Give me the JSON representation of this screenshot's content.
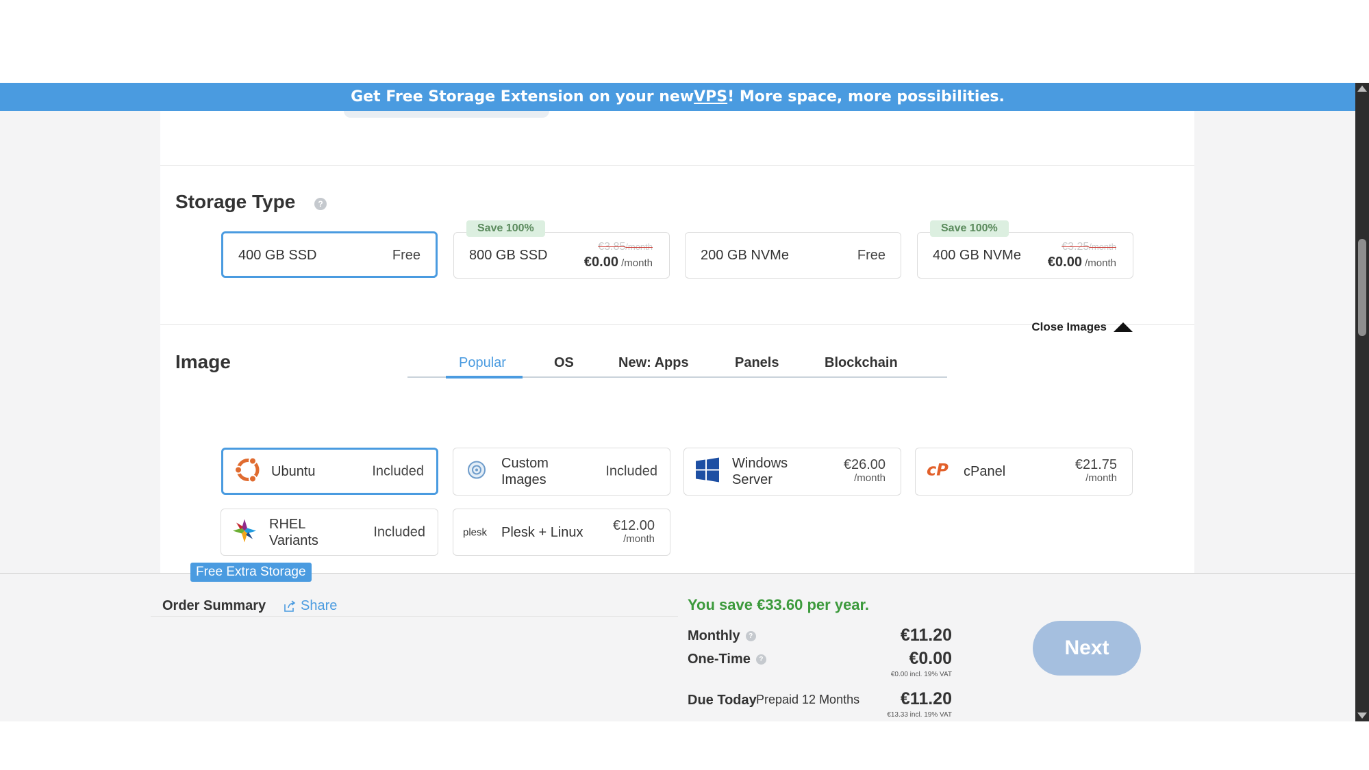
{
  "banner": {
    "text_before": "Get Free Storage Extension on your new ",
    "link": "VPS",
    "text_after": "! More space, more possibilities."
  },
  "storage": {
    "title": "Storage Type",
    "help": "?",
    "options": [
      {
        "name": "400 GB SSD",
        "price": "Free",
        "selected": true
      },
      {
        "name": "800 GB SSD",
        "save": "Save 100%",
        "old_price": "€3.85",
        "old_unit": "/month",
        "new_price": "€0.00",
        "new_unit": " /month"
      },
      {
        "name": "200 GB NVMe",
        "price": "Free"
      },
      {
        "name": "400 GB NVMe",
        "save": "Save 100%",
        "old_price": "€3.25",
        "old_unit": "/month",
        "new_price": "€0.00",
        "new_unit": " /month"
      }
    ]
  },
  "image": {
    "title": "Image",
    "close_label": "Close Images",
    "tabs": [
      "Popular",
      "OS",
      "New: Apps",
      "Panels",
      "Blockchain"
    ],
    "active_tab": "Popular",
    "options": [
      {
        "name": "Ubuntu",
        "price": "Included",
        "icon": "ubuntu-icon",
        "selected": true
      },
      {
        "name_line1": "Custom",
        "name_line2": "Images",
        "price": "Included",
        "icon": "custom-images-icon"
      },
      {
        "name_line1": "Windows",
        "name_line2": "Server",
        "price": "€26.00",
        "unit": "/month",
        "icon": "windows-icon"
      },
      {
        "name": "cPanel",
        "price": "€21.75",
        "unit": "/month",
        "icon": "cpanel-icon"
      },
      {
        "name_line1": "RHEL",
        "name_line2": "Variants",
        "price": "Included",
        "icon": "rhel-icon"
      },
      {
        "name": "Plesk + Linux",
        "price": "€12.00",
        "unit": "/month",
        "icon": "plesk-icon",
        "icon_text": "plesk"
      }
    ]
  },
  "footer": {
    "free_extra_label": "Free Extra Storage",
    "order_summary": "Order Summary",
    "share": "Share",
    "savings": "You save €33.60 per year.",
    "monthly_label": "Monthly",
    "monthly_value": "€11.20",
    "onetime_label": "One-Time",
    "onetime_value": "€0.00",
    "onetime_note": "€0.00 incl. 19% VAT",
    "due_label": "Due Today",
    "due_sub": "Prepaid 12 Months",
    "due_value": "€11.20",
    "due_note": "€13.33 incl. 19% VAT",
    "next_label": "Next"
  },
  "colors": {
    "accent": "#4a9be0",
    "savings_green": "#3c9a3c",
    "next_disabled": "#a5bfdf"
  }
}
